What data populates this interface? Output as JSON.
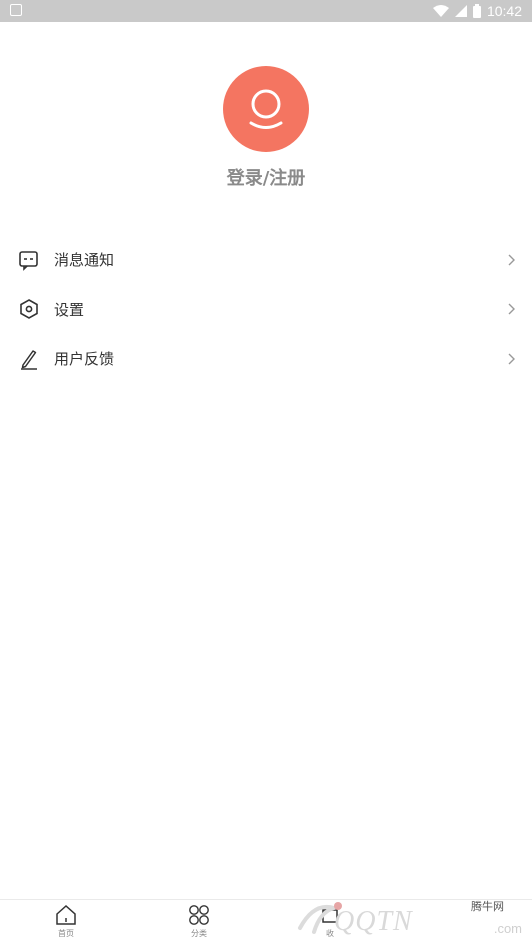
{
  "status_bar": {
    "time": "10:42"
  },
  "profile": {
    "login_label": "登录/注册"
  },
  "menu": {
    "items": [
      {
        "label": "消息通知",
        "icon": "message-icon"
      },
      {
        "label": "设置",
        "icon": "hexagon-settings-icon"
      },
      {
        "label": "用户反馈",
        "icon": "pen-icon"
      }
    ]
  },
  "tabbar": {
    "tabs": [
      {
        "label": "首页",
        "icon": "home-icon"
      },
      {
        "label": "分类",
        "icon": "grid-icon"
      },
      {
        "label": "收",
        "icon": "collect-icon"
      }
    ]
  },
  "watermark": {
    "text": "QQTN",
    "dotcom": ".com",
    "cn": "腾牛网"
  },
  "colors": {
    "avatar": "#f47561",
    "status_bar": "#c9c9c9"
  }
}
